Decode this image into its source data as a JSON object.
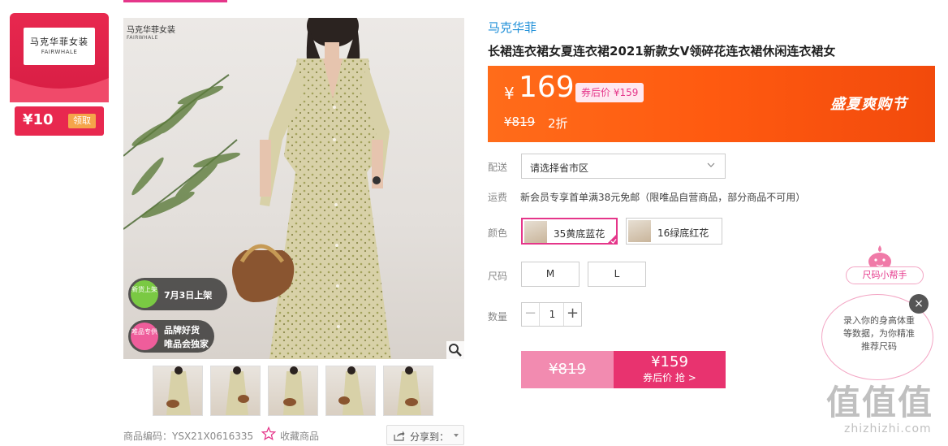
{
  "coupon": {
    "brand_cn": "马克华菲女装",
    "brand_en": "FAIRWHALE",
    "value": "¥10",
    "claim_label": "领取"
  },
  "image": {
    "brand_cn": "马克华菲女装",
    "brand_en": "FAIRWHALE",
    "badge1_circle": "新货上架",
    "badge1_text": "7月3日上架",
    "badge2_circle": "唯品专供",
    "badge2_line1": "品牌好货",
    "badge2_line2": "唯品会独家",
    "zoom_icon": "magnifier-icon"
  },
  "thumbnails": [
    "thumb1",
    "thumb2",
    "thumb3",
    "thumb4",
    "thumb5"
  ],
  "meta": {
    "sku": "商品编码：YSX21X0616335",
    "favorite_label": "收藏商品",
    "share_label": "分享到："
  },
  "product": {
    "brand": "马克华菲",
    "title": "长裙连衣裙女夏连衣裙2021新款女V领碎花连衣裙休闲连衣裙女"
  },
  "price": {
    "currency": "¥",
    "current": "169",
    "coupon_price": "券后价 ¥159",
    "original": "¥819",
    "discount": "2折",
    "promo": "盛夏爽购节"
  },
  "delivery": {
    "label": "配送",
    "value": "请选择省市区"
  },
  "shipping": {
    "label": "运费",
    "text": "新会员专享首单满38元免邮（限唯品自营商品，部分商品不可用）"
  },
  "color": {
    "label": "颜色",
    "options": [
      {
        "label": "35黄底蓝花",
        "selected": true
      },
      {
        "label": "16绿底红花",
        "selected": false
      }
    ]
  },
  "size": {
    "label": "尺码",
    "options": [
      "M",
      "L"
    ]
  },
  "quantity": {
    "label": "数量",
    "minus": "−",
    "value": "1",
    "plus": "+"
  },
  "buy": {
    "old_price": "¥819",
    "price": "¥159",
    "action": "券后价 抢 >"
  },
  "helper": {
    "tag": "尺码小帮手",
    "text": "录入你的身高体重等数据，为你精准推荐尺码",
    "close": "×"
  },
  "watermark": {
    "big": "值值值",
    "small": "zhizhizhi.com"
  },
  "colors": {
    "accent_pink": "#e5368a",
    "coupon_red": "#e8284f",
    "price_orange": "#ff5a10",
    "link_blue": "#1e8fd8"
  }
}
